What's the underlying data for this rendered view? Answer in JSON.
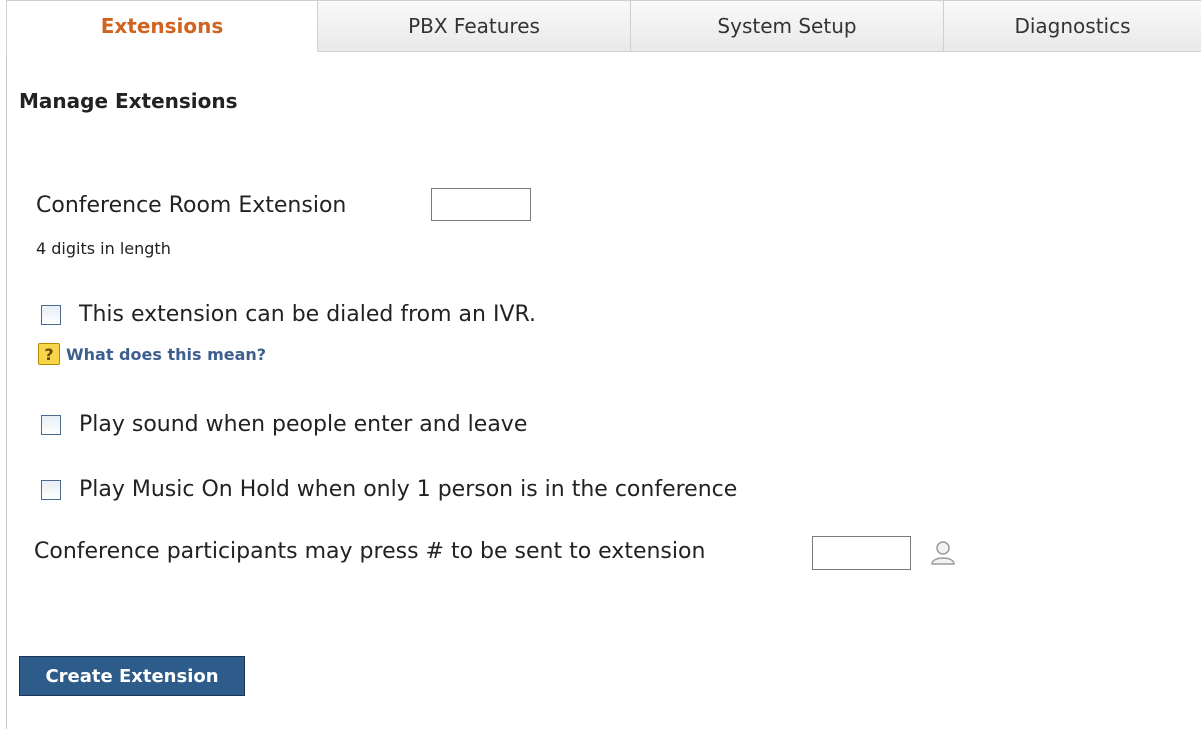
{
  "tabs": [
    {
      "label": "Extensions",
      "active": true
    },
    {
      "label": "PBX Features",
      "active": false
    },
    {
      "label": "System Setup",
      "active": false
    },
    {
      "label": "Diagnostics",
      "active": false
    }
  ],
  "page": {
    "title": "Manage Extensions"
  },
  "form": {
    "conference_extension": {
      "label": "Conference Room Extension",
      "value": "",
      "hint": "4 digits in length"
    },
    "ivr_dialable": {
      "label": "This extension can be dialed from an IVR.",
      "checked": false
    },
    "help_link": {
      "label": "What does this mean?"
    },
    "enter_leave_sound": {
      "label": "Play sound when people enter and leave",
      "checked": false
    },
    "music_on_hold": {
      "label": "Play Music On Hold when only 1 person is in the conference",
      "checked": false
    },
    "hash_transfer": {
      "label": "Conference participants may press # to be sent to extension",
      "value": ""
    },
    "submit": {
      "label": "Create Extension"
    }
  },
  "colors": {
    "active_tab_text": "#d0631f",
    "link": "#3d5f8e",
    "button_bg": "#2e5c8a"
  },
  "icons": {
    "help": "question-icon",
    "user_picker": "user-icon"
  }
}
